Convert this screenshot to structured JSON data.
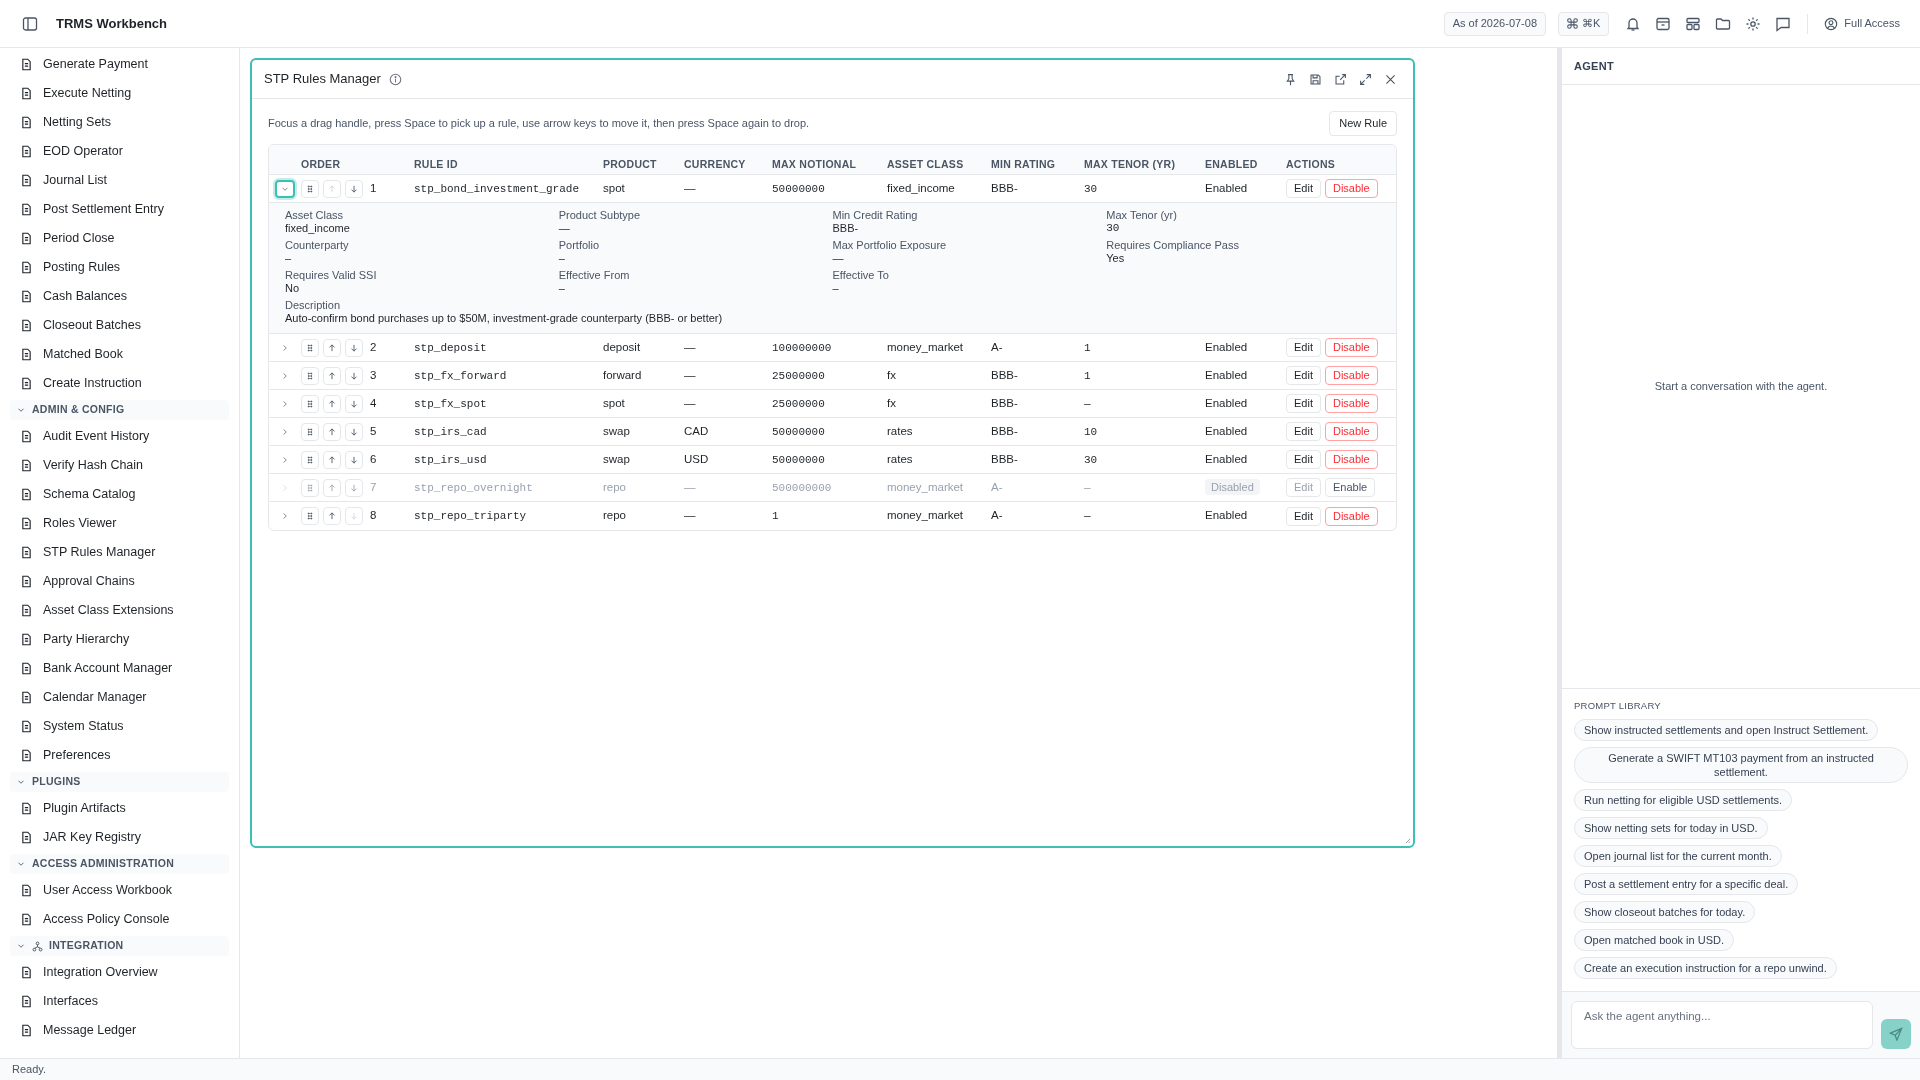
{
  "app": {
    "title": "TRMS Workbench",
    "as_of": "As of 2026-07-08",
    "shortcut": "⌘K",
    "access": "Full Access"
  },
  "sidebar": {
    "items": [
      {
        "label": "Generate Payment"
      },
      {
        "label": "Execute Netting"
      },
      {
        "label": "Netting Sets"
      },
      {
        "label": "EOD Operator"
      },
      {
        "label": "Journal List"
      },
      {
        "label": "Post Settlement Entry"
      },
      {
        "label": "Period Close"
      },
      {
        "label": "Posting Rules"
      },
      {
        "label": "Cash Balances"
      },
      {
        "label": "Closeout Batches"
      },
      {
        "label": "Matched Book"
      },
      {
        "label": "Create Instruction"
      }
    ],
    "sections": [
      {
        "title": "ADMIN & CONFIG",
        "expanded": true,
        "has_icon": false,
        "items": [
          {
            "label": "Audit Event History"
          },
          {
            "label": "Verify Hash Chain"
          },
          {
            "label": "Schema Catalog"
          },
          {
            "label": "Roles Viewer"
          },
          {
            "label": "STP Rules Manager"
          },
          {
            "label": "Approval Chains"
          },
          {
            "label": "Asset Class Extensions"
          },
          {
            "label": "Party Hierarchy"
          },
          {
            "label": "Bank Account Manager"
          },
          {
            "label": "Calendar Manager"
          },
          {
            "label": "System Status"
          },
          {
            "label": "Preferences"
          }
        ]
      },
      {
        "title": "PLUGINS",
        "expanded": true,
        "has_icon": false,
        "items": [
          {
            "label": "Plugin Artifacts"
          },
          {
            "label": "JAR Key Registry"
          }
        ]
      },
      {
        "title": "ACCESS ADMINISTRATION",
        "expanded": true,
        "has_icon": false,
        "items": [
          {
            "label": "User Access Workbook"
          },
          {
            "label": "Access Policy Console"
          }
        ]
      },
      {
        "title": "INTEGRATION",
        "expanded": true,
        "has_icon": true,
        "items": [
          {
            "label": "Integration Overview"
          },
          {
            "label": "Interfaces"
          },
          {
            "label": "Message Ledger"
          }
        ]
      }
    ]
  },
  "panel": {
    "title": "STP Rules Manager",
    "hint": "Focus a drag handle, press Space to pick up a rule, use arrow keys to move it, then press Space again to drop.",
    "new_button": "New Rule",
    "columns": [
      "ORDER",
      "RULE ID",
      "PRODUCT",
      "CURRENCY",
      "MAX NOTIONAL",
      "ASSET CLASS",
      "MIN RATING",
      "MAX TENOR (YR)",
      "ENABLED",
      "ACTIONS"
    ],
    "rows": [
      {
        "order": "1",
        "rule_id": "stp_bond_investment_grade",
        "product": "spot",
        "currency": "—",
        "max_notional": "50000000",
        "asset_class": "fixed_income",
        "min_rating": "BBB-",
        "max_tenor": "30",
        "status": "Enabled",
        "edit": "Edit",
        "action": "Disable",
        "enabled": true,
        "expanded": true,
        "focused": true,
        "up_disabled": true,
        "down_disabled": false,
        "details": [
          {
            "label": "Asset Class",
            "value": "fixed_income",
            "mono": false
          },
          {
            "label": "Product Subtype",
            "value": "—",
            "mono": false
          },
          {
            "label": "Min Credit Rating",
            "value": "BBB-",
            "mono": false
          },
          {
            "label": "Max Tenor (yr)",
            "value": "30",
            "mono": true
          },
          {
            "label": "Counterparty",
            "value": "–",
            "mono": false
          },
          {
            "label": "Portfolio",
            "value": "–",
            "mono": false
          },
          {
            "label": "Max Portfolio Exposure",
            "value": "—",
            "mono": false
          },
          {
            "label": "Requires Compliance Pass",
            "value": "Yes",
            "mono": false
          },
          {
            "label": "Requires Valid SSI",
            "value": "No",
            "mono": false
          },
          {
            "label": "Effective From",
            "value": "–",
            "mono": false
          },
          {
            "label": "Effective To",
            "value": "–",
            "mono": false
          }
        ],
        "description_label": "Description",
        "description": "Auto-confirm bond purchases up to $50M, investment-grade counterparty (BBB- or better)"
      },
      {
        "order": "2",
        "rule_id": "stp_deposit",
        "product": "deposit",
        "currency": "—",
        "max_notional": "100000000",
        "asset_class": "money_market",
        "min_rating": "A-",
        "max_tenor": "1",
        "status": "Enabled",
        "edit": "Edit",
        "action": "Disable",
        "enabled": true,
        "expanded": false,
        "focused": false,
        "up_disabled": false,
        "down_disabled": false
      },
      {
        "order": "3",
        "rule_id": "stp_fx_forward",
        "product": "forward",
        "currency": "—",
        "max_notional": "25000000",
        "asset_class": "fx",
        "min_rating": "BBB-",
        "max_tenor": "1",
        "status": "Enabled",
        "edit": "Edit",
        "action": "Disable",
        "enabled": true,
        "expanded": false,
        "focused": false,
        "up_disabled": false,
        "down_disabled": false
      },
      {
        "order": "4",
        "rule_id": "stp_fx_spot",
        "product": "spot",
        "currency": "—",
        "max_notional": "25000000",
        "asset_class": "fx",
        "min_rating": "BBB-",
        "max_tenor": "—",
        "status": "Enabled",
        "edit": "Edit",
        "action": "Disable",
        "enabled": true,
        "expanded": false,
        "focused": false,
        "up_disabled": false,
        "down_disabled": false
      },
      {
        "order": "5",
        "rule_id": "stp_irs_cad",
        "product": "swap",
        "currency": "CAD",
        "max_notional": "50000000",
        "asset_class": "rates",
        "min_rating": "BBB-",
        "max_tenor": "10",
        "status": "Enabled",
        "edit": "Edit",
        "action": "Disable",
        "enabled": true,
        "expanded": false,
        "focused": false,
        "up_disabled": false,
        "down_disabled": false
      },
      {
        "order": "6",
        "rule_id": "stp_irs_usd",
        "product": "swap",
        "currency": "USD",
        "max_notional": "50000000",
        "asset_class": "rates",
        "min_rating": "BBB-",
        "max_tenor": "30",
        "status": "Enabled",
        "edit": "Edit",
        "action": "Disable",
        "enabled": true,
        "expanded": false,
        "focused": false,
        "up_disabled": false,
        "down_disabled": false
      },
      {
        "order": "7",
        "rule_id": "stp_repo_overnight",
        "product": "repo",
        "currency": "—",
        "max_notional": "500000000",
        "asset_class": "money_market",
        "min_rating": "A-",
        "max_tenor": "—",
        "status": "Disabled",
        "edit": "Edit",
        "action": "Enable",
        "enabled": false,
        "expanded": false,
        "focused": false,
        "up_disabled": false,
        "down_disabled": false
      },
      {
        "order": "8",
        "rule_id": "stp_repo_triparty",
        "product": "repo",
        "currency": "—",
        "max_notional": "1",
        "asset_class": "money_market",
        "min_rating": "A-",
        "max_tenor": "—",
        "status": "Enabled",
        "edit": "Edit",
        "action": "Disable",
        "enabled": true,
        "expanded": false,
        "focused": false,
        "up_disabled": false,
        "down_disabled": true
      }
    ]
  },
  "agent": {
    "title": "AGENT",
    "empty": "Start a conversation with the agent.",
    "library_title": "PROMPT LIBRARY",
    "prompts": [
      "Show instructed settlements and open Instruct Settlement.",
      "Generate a SWIFT MT103 payment from an instructed settlement.",
      "Run netting for eligible USD settlements.",
      "Show netting sets for today in USD.",
      "Open journal list for the current month.",
      "Post a settlement entry for a specific deal.",
      "Show closeout batches for today.",
      "Open matched book in USD.",
      "Create an execution instruction for a repo unwind."
    ],
    "placeholder": "Ask the agent anything..."
  },
  "status_bar": "Ready."
}
